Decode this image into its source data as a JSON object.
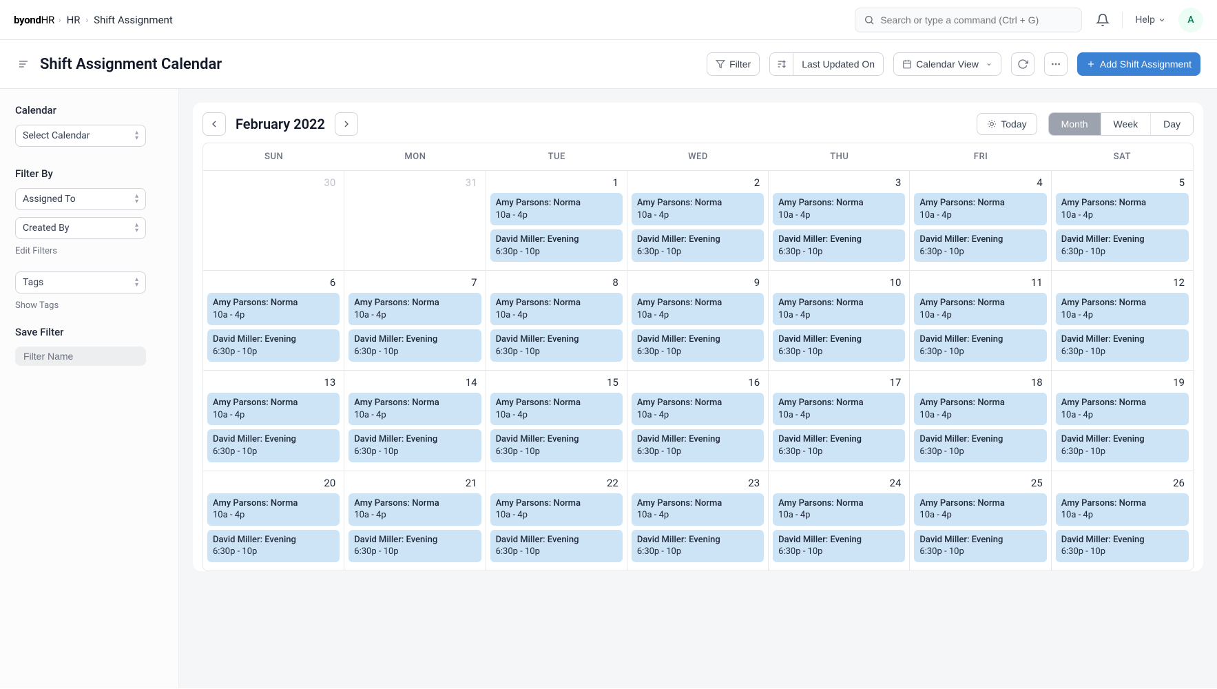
{
  "brand": {
    "main": "byond",
    "suffix": "HR"
  },
  "breadcrumb": {
    "item1": "HR",
    "item2": "Shift Assignment"
  },
  "search": {
    "placeholder": "Search or type a command (Ctrl + G)"
  },
  "help": {
    "label": "Help"
  },
  "avatar": {
    "initial": "A"
  },
  "page": {
    "title": "Shift Assignment Calendar"
  },
  "toolbar": {
    "filter": "Filter",
    "sort_label": "Last Updated On",
    "view_label": "Calendar View",
    "add_label": "Add Shift Assignment"
  },
  "sidebar": {
    "calendar_heading": "Calendar",
    "select_calendar": "Select Calendar",
    "filter_by_heading": "Filter By",
    "assigned_to": "Assigned To",
    "created_by": "Created By",
    "edit_filters": "Edit Filters",
    "tags": "Tags",
    "show_tags": "Show Tags",
    "save_filter_heading": "Save Filter",
    "filter_name_placeholder": "Filter Name"
  },
  "calendar": {
    "month_label": "February 2022",
    "today": "Today",
    "views": {
      "month": "Month",
      "week": "Week",
      "day": "Day"
    },
    "day_headers": [
      "SUN",
      "MON",
      "TUE",
      "WED",
      "THU",
      "FRI",
      "SAT"
    ],
    "event_templates": {
      "amy": {
        "title": "Amy Parsons: Norma",
        "time": "10a - 4p"
      },
      "david": {
        "title": "David Miller: Evening",
        "time": "6:30p - 10p"
      }
    },
    "weeks": [
      [
        {
          "num": "30",
          "outside": true,
          "events": []
        },
        {
          "num": "31",
          "outside": true,
          "events": []
        },
        {
          "num": "1",
          "events": [
            "amy",
            "david"
          ]
        },
        {
          "num": "2",
          "events": [
            "amy",
            "david"
          ]
        },
        {
          "num": "3",
          "events": [
            "amy",
            "david"
          ]
        },
        {
          "num": "4",
          "events": [
            "amy",
            "david"
          ]
        },
        {
          "num": "5",
          "events": [
            "amy",
            "david"
          ]
        }
      ],
      [
        {
          "num": "6",
          "events": [
            "amy",
            "david"
          ]
        },
        {
          "num": "7",
          "events": [
            "amy",
            "david"
          ]
        },
        {
          "num": "8",
          "events": [
            "amy",
            "david"
          ]
        },
        {
          "num": "9",
          "events": [
            "amy",
            "david"
          ]
        },
        {
          "num": "10",
          "events": [
            "amy",
            "david"
          ]
        },
        {
          "num": "11",
          "events": [
            "amy",
            "david"
          ]
        },
        {
          "num": "12",
          "events": [
            "amy",
            "david"
          ]
        }
      ],
      [
        {
          "num": "13",
          "events": [
            "amy",
            "david"
          ]
        },
        {
          "num": "14",
          "events": [
            "amy",
            "david"
          ]
        },
        {
          "num": "15",
          "events": [
            "amy",
            "david"
          ]
        },
        {
          "num": "16",
          "events": [
            "amy",
            "david"
          ]
        },
        {
          "num": "17",
          "events": [
            "amy",
            "david"
          ]
        },
        {
          "num": "18",
          "events": [
            "amy",
            "david"
          ]
        },
        {
          "num": "19",
          "events": [
            "amy",
            "david"
          ]
        }
      ],
      [
        {
          "num": "20",
          "events": [
            "amy",
            "david"
          ]
        },
        {
          "num": "21",
          "events": [
            "amy",
            "david"
          ]
        },
        {
          "num": "22",
          "events": [
            "amy",
            "david"
          ]
        },
        {
          "num": "23",
          "events": [
            "amy",
            "david"
          ]
        },
        {
          "num": "24",
          "events": [
            "amy",
            "david"
          ]
        },
        {
          "num": "25",
          "events": [
            "amy",
            "david"
          ]
        },
        {
          "num": "26",
          "events": [
            "amy",
            "david"
          ]
        }
      ]
    ]
  }
}
